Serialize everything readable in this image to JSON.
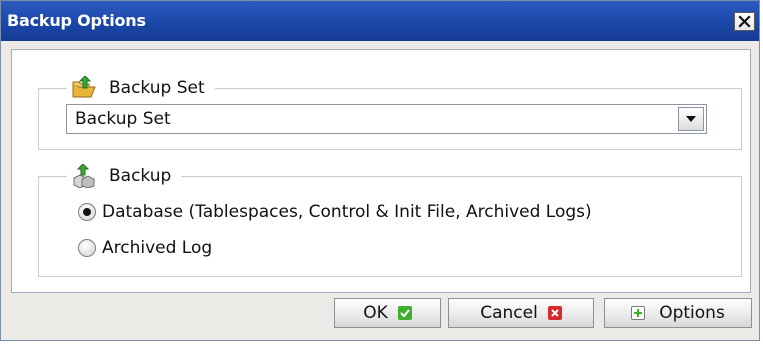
{
  "dialog": {
    "title": "Backup Options",
    "close_label": "×"
  },
  "backup_set": {
    "group_label": "Backup Set",
    "icon": "folder-up-icon",
    "selected_value": "Backup Set"
  },
  "backup": {
    "group_label": "Backup",
    "icon": "backup-cubes-icon",
    "options": [
      {
        "label": "Database (Tablespaces, Control & Init File, Archived Logs)",
        "checked": true
      },
      {
        "label": "Archived Log",
        "checked": false
      }
    ]
  },
  "buttons": {
    "ok_label": "OK",
    "cancel_label": "Cancel",
    "options_label": "Options"
  },
  "colors": {
    "title_bar": "#1b47a8",
    "ok_badge": "#3fae2c",
    "cancel_badge": "#d42a2a",
    "options_badge": "#3fae2c"
  }
}
